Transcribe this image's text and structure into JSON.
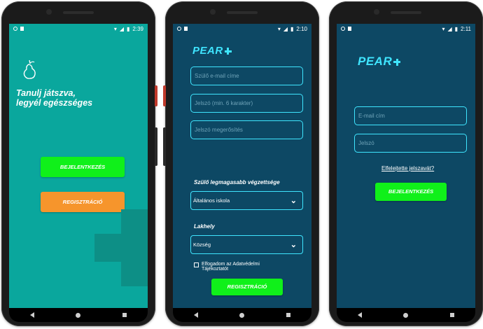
{
  "screens": [
    {
      "status": {
        "time": "2:39"
      },
      "tagline_line1": "Tanulj játszva,",
      "tagline_line2": "legyél egészséges",
      "login_label": "BEJELENTKEZÉS",
      "register_label": "REGISZTRÁCIÓ",
      "colors": {
        "background": "#0aa79d",
        "login": "#10f01a",
        "register": "#f6952c"
      }
    },
    {
      "status": {
        "time": "2:10"
      },
      "logo": "PEAR",
      "email_placeholder": "Szülő e-mail címe",
      "password_placeholder": "Jelszó (min. 6 karakter)",
      "confirm_placeholder": "Jelszó megerősítés",
      "education_label": "Szülő legmagasabb végzettsége",
      "education_value": "Általános iskola",
      "residence_label": "Lakhely",
      "residence_value": "Község",
      "consent_line1": "Elfogadom az Adatvédelmi",
      "consent_line2": "Tájékoztatót",
      "register_label": "REGISZTRÁCIÓ",
      "colors": {
        "background": "#0d4864",
        "accent": "#3fe5ff"
      }
    },
    {
      "status": {
        "time": "2:11"
      },
      "logo": "PEAR",
      "email_placeholder": "E-mail cím",
      "password_placeholder": "Jelszó",
      "forgot_label": "Elfelejtette jelszavát?",
      "login_label": "BEJELENTKEZÉS",
      "colors": {
        "background": "#0d4864",
        "accent": "#3fe5ff"
      }
    }
  ],
  "icons": [
    "pear-icon",
    "plus-icon",
    "chevron-down-icon",
    "wifi-icon",
    "signal-icon",
    "battery-icon",
    "back-icon",
    "home-icon",
    "recents-icon"
  ]
}
